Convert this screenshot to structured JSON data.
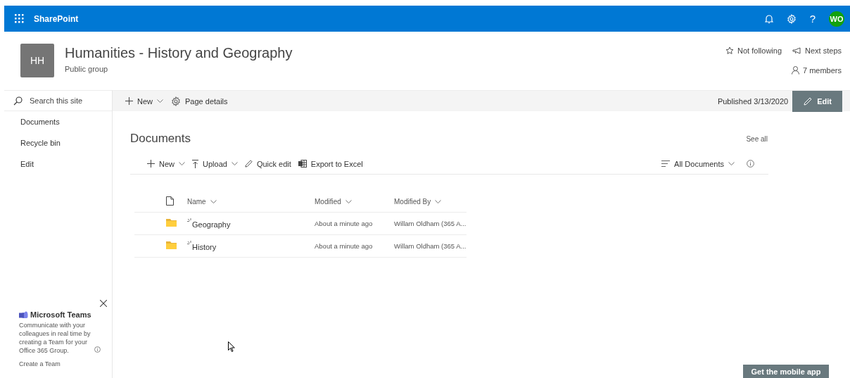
{
  "suite_bar": {
    "app_name": "SharePoint",
    "help_label": "?",
    "avatar_initials": "WO"
  },
  "site_header": {
    "logo_initials": "HH",
    "title": "Humanities - History and Geography",
    "subtitle": "Public group",
    "actions": [
      {
        "kind": "follow",
        "label": "Not following"
      },
      {
        "kind": "next_steps",
        "label": "Next steps"
      },
      {
        "kind": "members",
        "label": "7 members"
      }
    ]
  },
  "left_nav": {
    "search_placeholder": "Search this site",
    "items": [
      {
        "label": "Documents"
      },
      {
        "label": "Recycle bin"
      },
      {
        "label": "Edit"
      }
    ]
  },
  "command_bar": {
    "items": [
      {
        "kind": "new",
        "label": "New"
      },
      {
        "kind": "details",
        "label": "Page details"
      }
    ],
    "published": "Published 3/13/2020",
    "edit_label": "Edit"
  },
  "documents": {
    "title": "Documents",
    "see_all": "See all",
    "toolbar": [
      {
        "kind": "new",
        "label": "New"
      },
      {
        "kind": "upload",
        "label": "Upload"
      },
      {
        "kind": "quick_edit",
        "label": "Quick edit"
      },
      {
        "kind": "export",
        "label": "Export to Excel"
      }
    ],
    "view": "All Documents",
    "columns": [
      "Name",
      "Modified",
      "Modified By"
    ],
    "rows": [
      {
        "name": "Geography",
        "modified": "About a minute ago",
        "modified_by": "Willam Oldham (365 A...",
        "is_new": true
      },
      {
        "name": "History",
        "modified": "About a minute ago",
        "modified_by": "Willam Oldham (365 A...",
        "is_new": true
      }
    ]
  },
  "teams_card": {
    "title": "Microsoft Teams",
    "description": "Communicate with your colleagues in real time by creating a Team for your Office 365 Group.",
    "link": "Create a Team"
  },
  "mobile_app_button": "Get the mobile app"
}
